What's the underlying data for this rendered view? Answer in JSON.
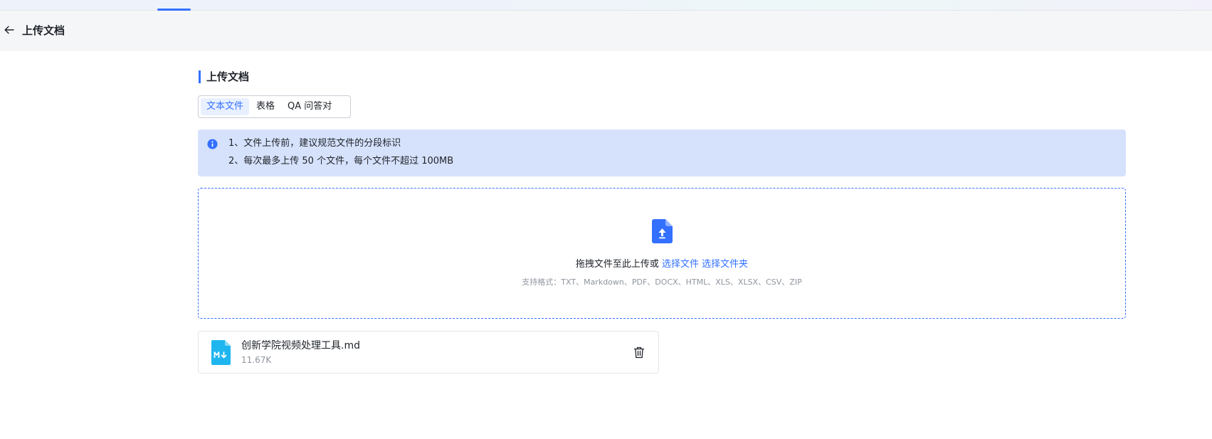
{
  "header": {
    "title": "上传文档",
    "back_icon": "arrow-left-icon"
  },
  "section": {
    "title": "上传文档"
  },
  "tabs": [
    {
      "label": "文本文件",
      "active": true
    },
    {
      "label": "表格",
      "active": false
    },
    {
      "label": "QA 问答对",
      "active": false
    }
  ],
  "notice": {
    "icon": "info-icon",
    "lines": [
      "1、文件上传前，建议规范文件的分段标识",
      "2、每次最多上传 50 个文件，每个文件不超过 100MB"
    ]
  },
  "dropzone": {
    "icon": "file-upload-icon",
    "prompt": "拖拽文件至此上传或",
    "select_file": "选择文件",
    "select_folder": "选择文件夹",
    "formats": "支持格式：TXT、Markdown、PDF、DOCX、HTML、XLS、XLSX、CSV、ZIP"
  },
  "files": [
    {
      "name": "创新学院视频处理工具.md",
      "size": "11.67K",
      "icon": "markdown-file-icon"
    }
  ],
  "colors": {
    "accent": "#3370ff",
    "notice_bg": "#d6e2fc",
    "markdown_icon": "#1fb6f0"
  }
}
